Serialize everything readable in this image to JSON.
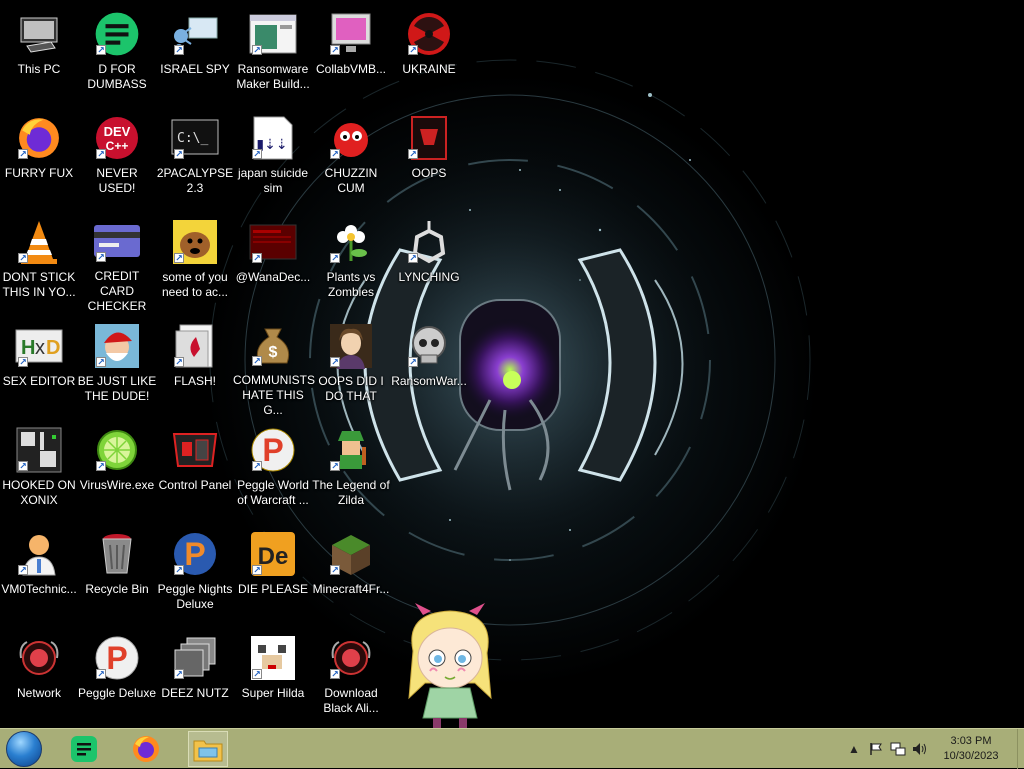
{
  "desktop": {
    "icons": [
      {
        "label": "This PC",
        "icon": "computer-icon"
      },
      {
        "label": "FURRY FUX",
        "icon": "firefox-icon"
      },
      {
        "label": "DONT STICK THIS IN YO...",
        "icon": "vlc-cone-icon"
      },
      {
        "label": "SEX EDITOR",
        "icon": "hxd-icon"
      },
      {
        "label": "HOOKED ON XONIX",
        "icon": "xonix-icon"
      },
      {
        "label": "VM0Technic...",
        "icon": "doctor-icon"
      },
      {
        "label": "Network",
        "icon": "network-icon"
      },
      {
        "label": "D FOR DUMBASS",
        "icon": "green-chat-icon"
      },
      {
        "label": "NEVER USED!",
        "icon": "devcpp-icon"
      },
      {
        "label": "CREDIT CARD CHECKER",
        "icon": "credit-card-icon"
      },
      {
        "label": "BE JUST LIKE THE DUDE!",
        "icon": "santa-icon"
      },
      {
        "label": "VirusWire.exe",
        "icon": "lime-icon"
      },
      {
        "label": "Recycle Bin",
        "icon": "recycle-bin-icon"
      },
      {
        "label": "Peggle Deluxe",
        "icon": "peggle-icon"
      },
      {
        "label": "ISRAEL SPY",
        "icon": "network-spy-icon"
      },
      {
        "label": "2PACALYPSE 2.3",
        "icon": "terminal-icon"
      },
      {
        "label": "some of you need to ac...",
        "icon": "dog-icon"
      },
      {
        "label": "FLASH!",
        "icon": "flash-icon"
      },
      {
        "label": "Control Panel",
        "icon": "control-panel-icon"
      },
      {
        "label": "Peggle Nights Deluxe",
        "icon": "peggle-nights-icon"
      },
      {
        "label": "DEEZ NUTZ",
        "icon": "stacked-windows-icon"
      },
      {
        "label": "Ransomware Maker Build...",
        "icon": "app-window-icon"
      },
      {
        "label": "japan suicide sim",
        "icon": "game-doc-icon"
      },
      {
        "label": "@WanaDec...",
        "icon": "wanadecryptor-icon"
      },
      {
        "label": "COMMUNISTS HATE THIS G...",
        "icon": "money-bag-icon"
      },
      {
        "label": "Peggle World of Warcraft ...",
        "icon": "peggle-wow-icon"
      },
      {
        "label": "DIE PLEASE",
        "icon": "de-icon"
      },
      {
        "label": "Super Hilda",
        "icon": "pixel-dog-icon"
      },
      {
        "label": "CollabVMB...",
        "icon": "monitor-icon"
      },
      {
        "label": "CHUZZIN CUM",
        "icon": "chuzzle-icon"
      },
      {
        "label": "Plants vs Zombies",
        "icon": "flower-icon"
      },
      {
        "label": "OOPS DID I DO THAT",
        "icon": "portrait-icon"
      },
      {
        "label": "The Legend of Zilda",
        "icon": "zelda-icon"
      },
      {
        "label": "Minecraft4Fr...",
        "icon": "grass-block-icon"
      },
      {
        "label": "Download Black Ali...",
        "icon": "network-red-icon"
      },
      {
        "label": "UKRAINE",
        "icon": "radiation-icon"
      },
      {
        "label": "OOPS",
        "icon": "red-box-icon"
      },
      {
        "label": "LYNCHING",
        "icon": "noose-icon"
      },
      {
        "label": "RansomWar...",
        "icon": "skull-icon"
      }
    ]
  },
  "taskbar": {
    "start": "start-orb-icon",
    "pinned": [
      {
        "name": "green-chat-app-icon"
      },
      {
        "name": "firefox-icon"
      },
      {
        "name": "file-explorer-icon"
      }
    ],
    "tray": {
      "time": "3:03 PM",
      "date": "10/30/2023"
    }
  },
  "colors": {
    "taskbar_bg": "#a8ae78",
    "wallpaper_glow": "#1c2b33"
  }
}
